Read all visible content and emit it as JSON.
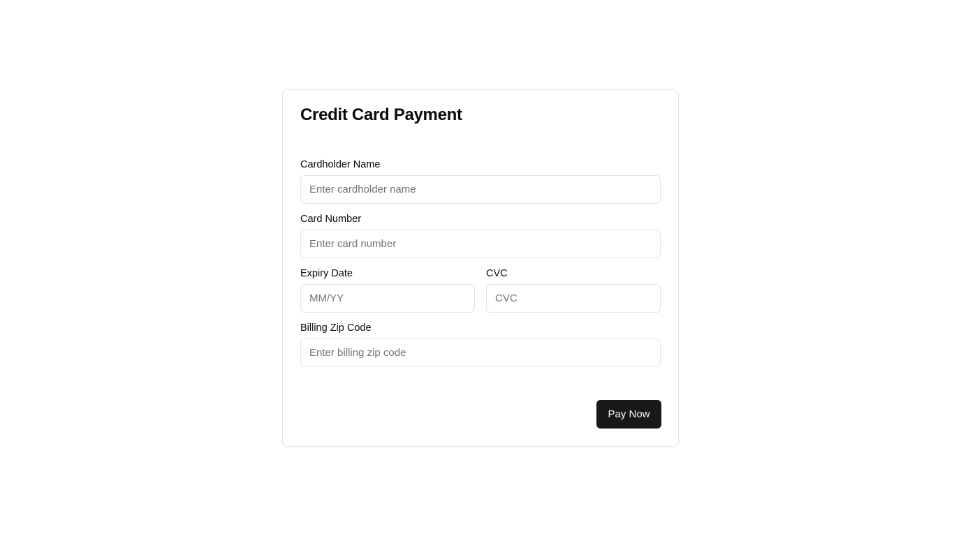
{
  "form": {
    "title": "Credit Card Payment",
    "fields": {
      "cardholder_name": {
        "label": "Cardholder Name",
        "value": "",
        "placeholder": "Enter cardholder name"
      },
      "card_number": {
        "label": "Card Number",
        "value": "",
        "placeholder": "Enter card number"
      },
      "expiry_date": {
        "label": "Expiry Date",
        "value": "",
        "placeholder": "MM/YY"
      },
      "cvc": {
        "label": "CVC",
        "value": "",
        "placeholder": "CVC"
      },
      "billing_zip": {
        "label": "Billing Zip Code",
        "value": "",
        "placeholder": "Enter billing zip code"
      }
    },
    "submit_label": "Pay Now"
  },
  "colors": {
    "primary_button": "#18181b",
    "border": "#e4e4e7",
    "placeholder": "#71717a",
    "text": "#0a0a0a"
  }
}
